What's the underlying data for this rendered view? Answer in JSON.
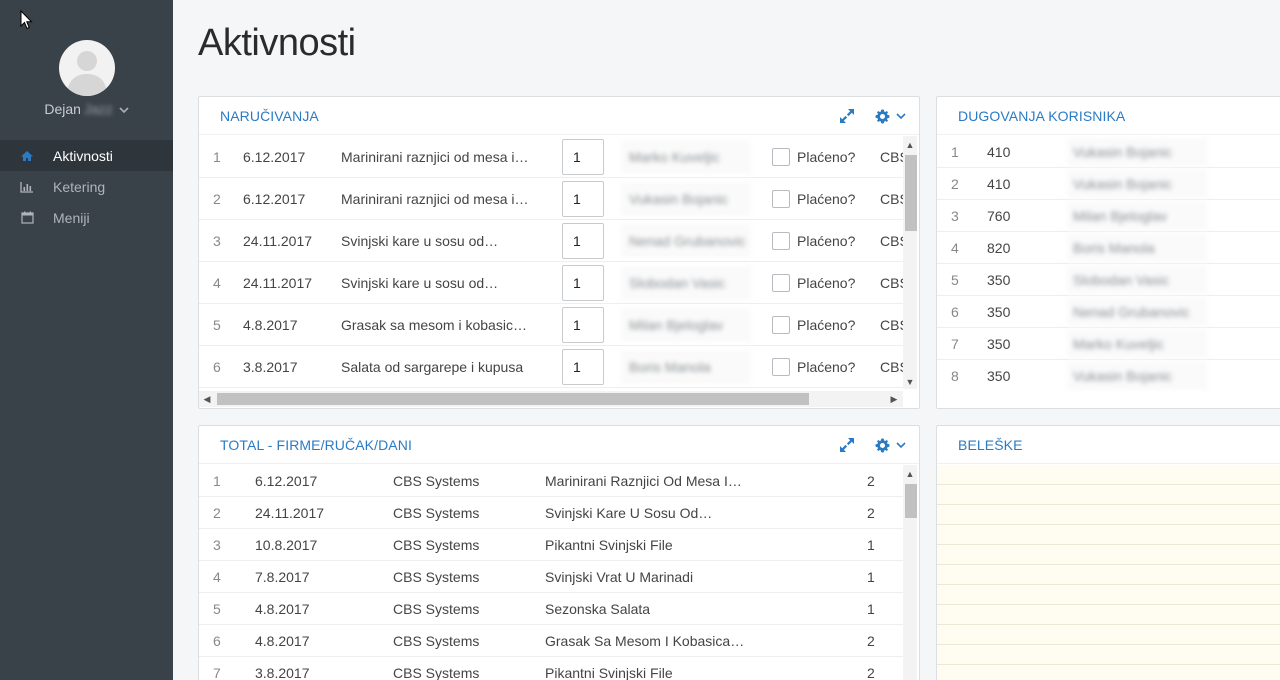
{
  "sidebar": {
    "user": {
      "first_name": "Dejan",
      "last_name": "Jazz"
    },
    "items": [
      {
        "label": "Aktivnosti",
        "icon": "home-icon",
        "active": true
      },
      {
        "label": "Ketering",
        "icon": "bar-chart-icon",
        "active": false
      },
      {
        "label": "Meniji",
        "icon": "calendar-icon",
        "active": false
      }
    ]
  },
  "page": {
    "title": "Aktivnosti"
  },
  "orders": {
    "title": "NARUČIVANJA",
    "paid_label": "Plaćeno?",
    "rows": [
      {
        "num": "1",
        "date": "6.12.2017",
        "meal": "Marinirani raznjici od mesa i…",
        "qty": "1",
        "user": "Marko Kuveljic",
        "firm": "CBS"
      },
      {
        "num": "2",
        "date": "6.12.2017",
        "meal": "Marinirani raznjici od mesa i…",
        "qty": "1",
        "user": "Vukasin Bojanic",
        "firm": "CBS"
      },
      {
        "num": "3",
        "date": "24.11.2017",
        "meal": "Svinjski kare u sosu od…",
        "qty": "1",
        "user": "Nenad Grubanovic",
        "firm": "CBS"
      },
      {
        "num": "4",
        "date": "24.11.2017",
        "meal": "Svinjski kare u sosu od…",
        "qty": "1",
        "user": "Slobodan Vasic",
        "firm": "CBS"
      },
      {
        "num": "5",
        "date": "4.8.2017",
        "meal": "Grasak sa mesom i kobasicama",
        "qty": "1",
        "user": "Milan Bjeloglav",
        "firm": "CBS"
      },
      {
        "num": "6",
        "date": "3.8.2017",
        "meal": "Salata od sargarepe i kupusa",
        "qty": "1",
        "user": "Boris Manola",
        "firm": "CBS"
      }
    ]
  },
  "debts": {
    "title": "DUGOVANJA KORISNIKA",
    "rows": [
      {
        "num": "1",
        "amount": "410",
        "user": "Vukasin Bojanic"
      },
      {
        "num": "2",
        "amount": "410",
        "user": "Vukasin Bojanic"
      },
      {
        "num": "3",
        "amount": "760",
        "user": "Milan Bjeloglav"
      },
      {
        "num": "4",
        "amount": "820",
        "user": "Boris Manola"
      },
      {
        "num": "5",
        "amount": "350",
        "user": "Slobodan Vasic"
      },
      {
        "num": "6",
        "amount": "350",
        "user": "Nenad Grubanovic"
      },
      {
        "num": "7",
        "amount": "350",
        "user": "Marko Kuveljic"
      },
      {
        "num": "8",
        "amount": "350",
        "user": "Vukasin Bojanic"
      }
    ]
  },
  "totals": {
    "title": "TOTAL - FIRME/RUČAK/DANI",
    "rows": [
      {
        "num": "1",
        "date": "6.12.2017",
        "firm": "CBS Systems",
        "meal": "Marinirani Raznjici Od Mesa I…",
        "count": "2"
      },
      {
        "num": "2",
        "date": "24.11.2017",
        "firm": "CBS Systems",
        "meal": "Svinjski Kare U Sosu Od…",
        "count": "2"
      },
      {
        "num": "3",
        "date": "10.8.2017",
        "firm": "CBS Systems",
        "meal": "Pikantni Svinjski File",
        "count": "1"
      },
      {
        "num": "4",
        "date": "7.8.2017",
        "firm": "CBS Systems",
        "meal": "Svinjski Vrat U Marinadi",
        "count": "1"
      },
      {
        "num": "5",
        "date": "4.8.2017",
        "firm": "CBS Systems",
        "meal": "Sezonska Salata",
        "count": "1"
      },
      {
        "num": "6",
        "date": "4.8.2017",
        "firm": "CBS Systems",
        "meal": "Grasak Sa Mesom I Kobasicama",
        "count": "2"
      },
      {
        "num": "7",
        "date": "3.8.2017",
        "firm": "CBS Systems",
        "meal": "Pikantni Svinjski File",
        "count": "2"
      }
    ]
  },
  "notes": {
    "title": "BELEŠKE"
  },
  "colors": {
    "accent": "#2b7bc4",
    "sidebar": "#3a4249",
    "sidebar_active": "#2e353b",
    "notes_bg": "#fffdf1"
  }
}
